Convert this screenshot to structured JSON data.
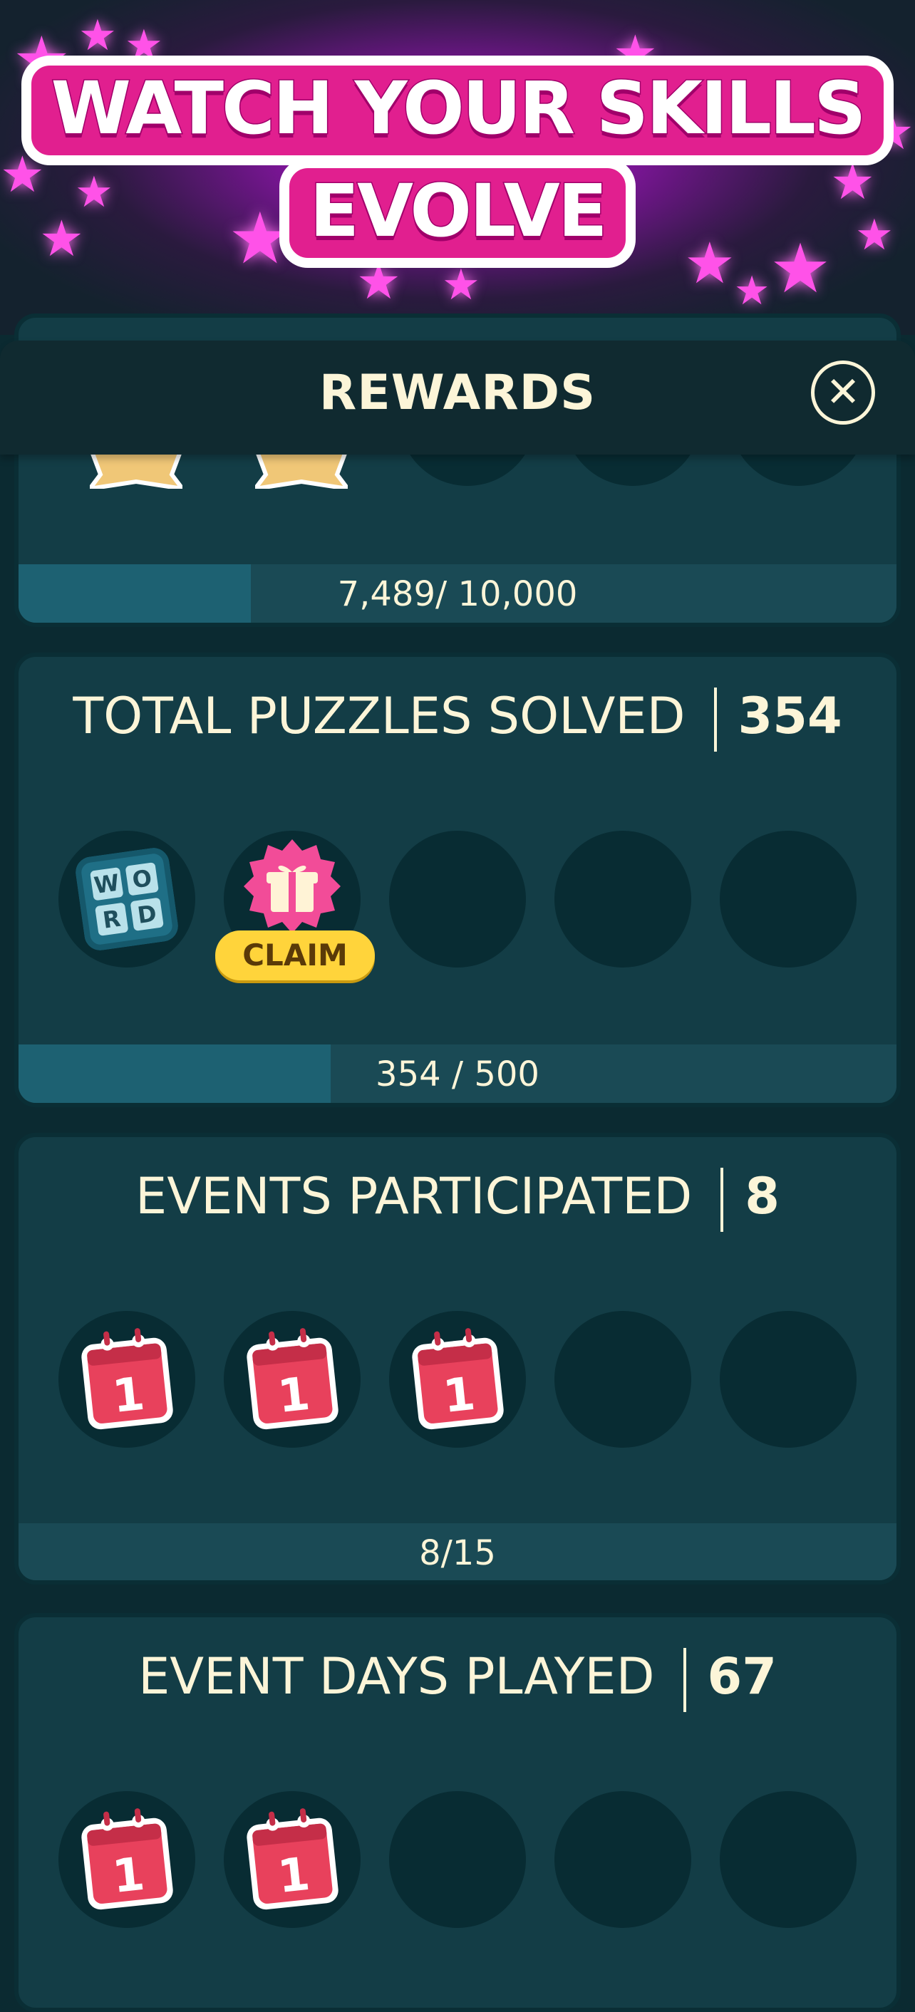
{
  "promo": {
    "headline_line1": "WATCH YOUR SKILLS",
    "headline_line2": "EVOLVE"
  },
  "header": {
    "title": "REWARDS",
    "close_icon": "close-icon",
    "close_glyph": "✕"
  },
  "colors": {
    "background": "#0b2a31",
    "card": "#133d46",
    "text": "#fcf5d8",
    "progress_fill": "#1d6172",
    "claim": "#ffd43b",
    "accent_pink": "#e11f8f"
  },
  "cards": [
    {
      "title": "",
      "count": "",
      "progress_label": "7,489/ 10,000",
      "progress_fraction": 0.7489,
      "fill_fraction_shown": 0.15
    },
    {
      "title": "TOTAL PUZZLES SOLVED",
      "count": "354",
      "claim_label": "CLAIM",
      "word_tiles": [
        "W",
        "O",
        "R",
        "D"
      ],
      "progress_label": "354 / 500",
      "progress_fraction": 0.708,
      "fill_fraction_shown": 0.2
    },
    {
      "title": "EVENTS PARTICIPATED",
      "count": "8",
      "calendar_digit": "1",
      "progress_label": "8/15",
      "progress_fraction": 0.533
    },
    {
      "title": "EVENT DAYS PLAYED",
      "count": "67",
      "calendar_digit": "1"
    }
  ]
}
